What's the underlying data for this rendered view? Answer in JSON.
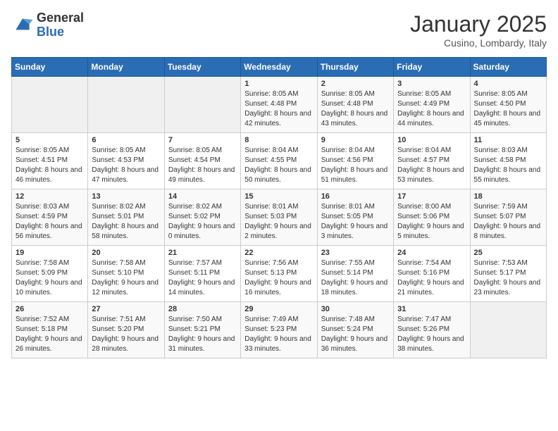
{
  "header": {
    "logo_general": "General",
    "logo_blue": "Blue",
    "title": "January 2025",
    "subtitle": "Cusino, Lombardy, Italy"
  },
  "weekdays": [
    "Sunday",
    "Monday",
    "Tuesday",
    "Wednesday",
    "Thursday",
    "Friday",
    "Saturday"
  ],
  "weeks": [
    [
      {
        "day": "",
        "info": ""
      },
      {
        "day": "",
        "info": ""
      },
      {
        "day": "",
        "info": ""
      },
      {
        "day": "1",
        "info": "Sunrise: 8:05 AM\nSunset: 4:48 PM\nDaylight: 8 hours and 42 minutes."
      },
      {
        "day": "2",
        "info": "Sunrise: 8:05 AM\nSunset: 4:48 PM\nDaylight: 8 hours and 43 minutes."
      },
      {
        "day": "3",
        "info": "Sunrise: 8:05 AM\nSunset: 4:49 PM\nDaylight: 8 hours and 44 minutes."
      },
      {
        "day": "4",
        "info": "Sunrise: 8:05 AM\nSunset: 4:50 PM\nDaylight: 8 hours and 45 minutes."
      }
    ],
    [
      {
        "day": "5",
        "info": "Sunrise: 8:05 AM\nSunset: 4:51 PM\nDaylight: 8 hours and 46 minutes."
      },
      {
        "day": "6",
        "info": "Sunrise: 8:05 AM\nSunset: 4:53 PM\nDaylight: 8 hours and 47 minutes."
      },
      {
        "day": "7",
        "info": "Sunrise: 8:05 AM\nSunset: 4:54 PM\nDaylight: 8 hours and 49 minutes."
      },
      {
        "day": "8",
        "info": "Sunrise: 8:04 AM\nSunset: 4:55 PM\nDaylight: 8 hours and 50 minutes."
      },
      {
        "day": "9",
        "info": "Sunrise: 8:04 AM\nSunset: 4:56 PM\nDaylight: 8 hours and 51 minutes."
      },
      {
        "day": "10",
        "info": "Sunrise: 8:04 AM\nSunset: 4:57 PM\nDaylight: 8 hours and 53 minutes."
      },
      {
        "day": "11",
        "info": "Sunrise: 8:03 AM\nSunset: 4:58 PM\nDaylight: 8 hours and 55 minutes."
      }
    ],
    [
      {
        "day": "12",
        "info": "Sunrise: 8:03 AM\nSunset: 4:59 PM\nDaylight: 8 hours and 56 minutes."
      },
      {
        "day": "13",
        "info": "Sunrise: 8:02 AM\nSunset: 5:01 PM\nDaylight: 8 hours and 58 minutes."
      },
      {
        "day": "14",
        "info": "Sunrise: 8:02 AM\nSunset: 5:02 PM\nDaylight: 9 hours and 0 minutes."
      },
      {
        "day": "15",
        "info": "Sunrise: 8:01 AM\nSunset: 5:03 PM\nDaylight: 9 hours and 2 minutes."
      },
      {
        "day": "16",
        "info": "Sunrise: 8:01 AM\nSunset: 5:05 PM\nDaylight: 9 hours and 3 minutes."
      },
      {
        "day": "17",
        "info": "Sunrise: 8:00 AM\nSunset: 5:06 PM\nDaylight: 9 hours and 5 minutes."
      },
      {
        "day": "18",
        "info": "Sunrise: 7:59 AM\nSunset: 5:07 PM\nDaylight: 9 hours and 8 minutes."
      }
    ],
    [
      {
        "day": "19",
        "info": "Sunrise: 7:58 AM\nSunset: 5:09 PM\nDaylight: 9 hours and 10 minutes."
      },
      {
        "day": "20",
        "info": "Sunrise: 7:58 AM\nSunset: 5:10 PM\nDaylight: 9 hours and 12 minutes."
      },
      {
        "day": "21",
        "info": "Sunrise: 7:57 AM\nSunset: 5:11 PM\nDaylight: 9 hours and 14 minutes."
      },
      {
        "day": "22",
        "info": "Sunrise: 7:56 AM\nSunset: 5:13 PM\nDaylight: 9 hours and 16 minutes."
      },
      {
        "day": "23",
        "info": "Sunrise: 7:55 AM\nSunset: 5:14 PM\nDaylight: 9 hours and 18 minutes."
      },
      {
        "day": "24",
        "info": "Sunrise: 7:54 AM\nSunset: 5:16 PM\nDaylight: 9 hours and 21 minutes."
      },
      {
        "day": "25",
        "info": "Sunrise: 7:53 AM\nSunset: 5:17 PM\nDaylight: 9 hours and 23 minutes."
      }
    ],
    [
      {
        "day": "26",
        "info": "Sunrise: 7:52 AM\nSunset: 5:18 PM\nDaylight: 9 hours and 26 minutes."
      },
      {
        "day": "27",
        "info": "Sunrise: 7:51 AM\nSunset: 5:20 PM\nDaylight: 9 hours and 28 minutes."
      },
      {
        "day": "28",
        "info": "Sunrise: 7:50 AM\nSunset: 5:21 PM\nDaylight: 9 hours and 31 minutes."
      },
      {
        "day": "29",
        "info": "Sunrise: 7:49 AM\nSunset: 5:23 PM\nDaylight: 9 hours and 33 minutes."
      },
      {
        "day": "30",
        "info": "Sunrise: 7:48 AM\nSunset: 5:24 PM\nDaylight: 9 hours and 36 minutes."
      },
      {
        "day": "31",
        "info": "Sunrise: 7:47 AM\nSunset: 5:26 PM\nDaylight: 9 hours and 38 minutes."
      },
      {
        "day": "",
        "info": ""
      }
    ]
  ]
}
